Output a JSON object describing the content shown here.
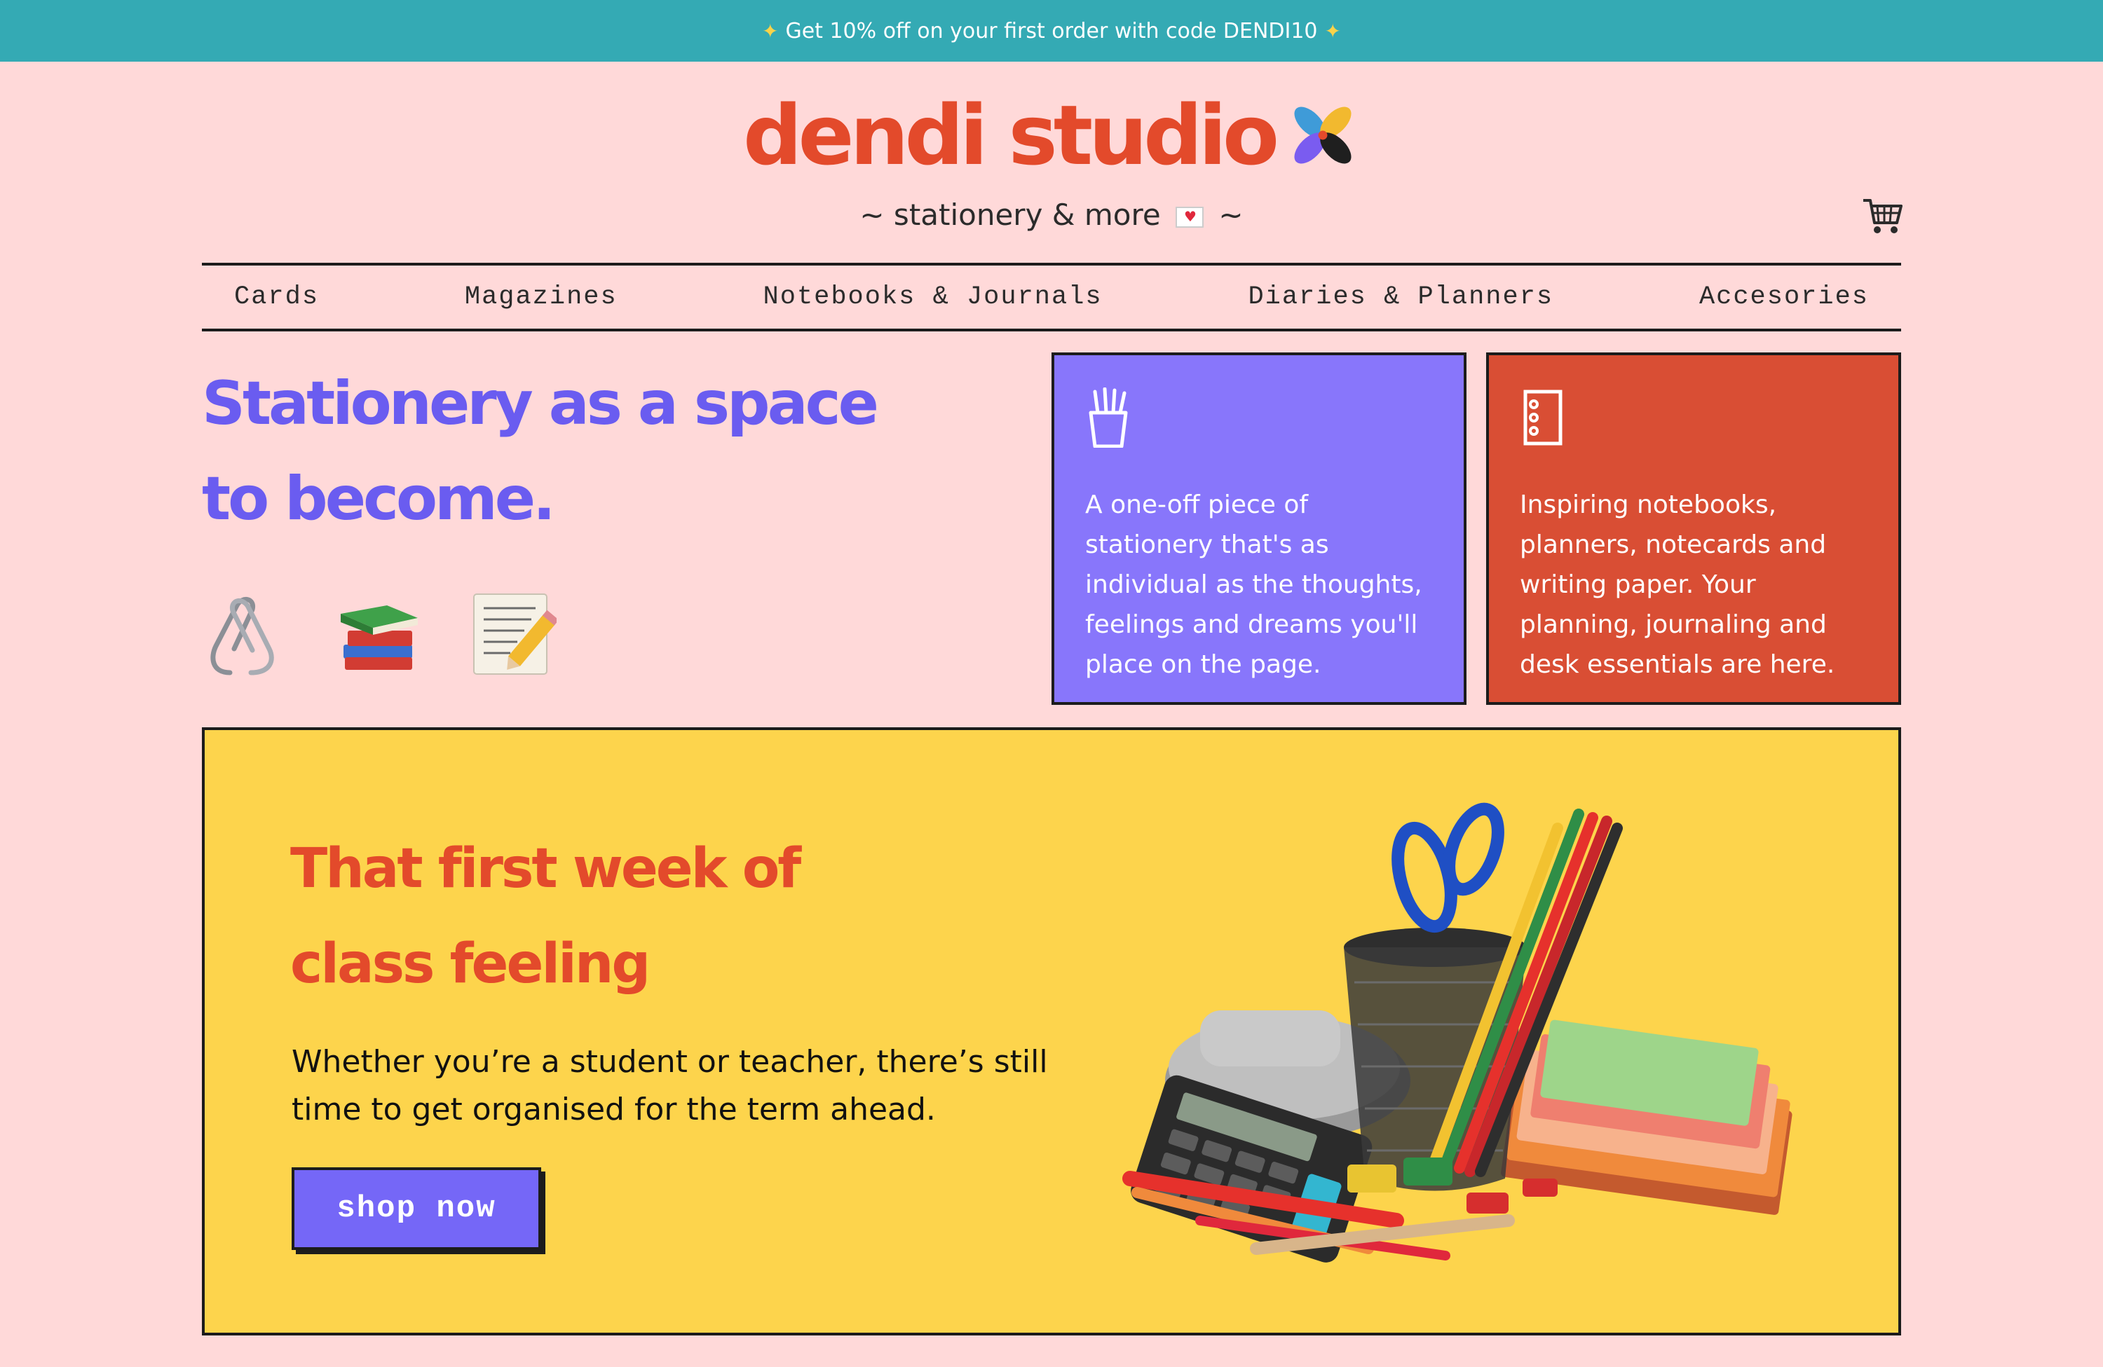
{
  "promo": {
    "text": "Get 10% off on your first order with code DENDI10",
    "icon": "sparkles-icon"
  },
  "brand": {
    "name": "dendi studio",
    "tagline": "~ stationery & more",
    "tagline_end": "~"
  },
  "header": {
    "cart_icon": "cart-icon"
  },
  "nav": {
    "items": [
      "Cards",
      "Magazines",
      "Notebooks & Journals",
      "Diaries & Planners",
      "Accesories"
    ]
  },
  "hero": {
    "title_line1": "Stationery as a space",
    "title_line2": "to become.",
    "emojis": [
      "paperclips-icon",
      "books-icon",
      "memo-icon"
    ]
  },
  "cards": [
    {
      "icon": "pencil-cup-icon",
      "text": "A one-off piece of stationery that's as individual as the thoughts, feelings and dreams you'll place on the page."
    },
    {
      "icon": "notebook-icon",
      "text": "Inspiring notebooks, planners, notecards and writing paper. Your planning, journaling and desk essentials are here."
    }
  ],
  "banner": {
    "title_line1": "That first week of",
    "title_line2": "class feeling",
    "copy": "Whether you’re a student or teacher, there’s still time to get organised for the term ahead.",
    "button": "shop now"
  },
  "colors": {
    "promo_bg": "#34AAB4",
    "page_bg": "#FFD9D9",
    "brand_red": "#E34A2B",
    "purple": "#8876FB",
    "orange": "#D94E34",
    "banner_bg": "#FDD44C"
  }
}
